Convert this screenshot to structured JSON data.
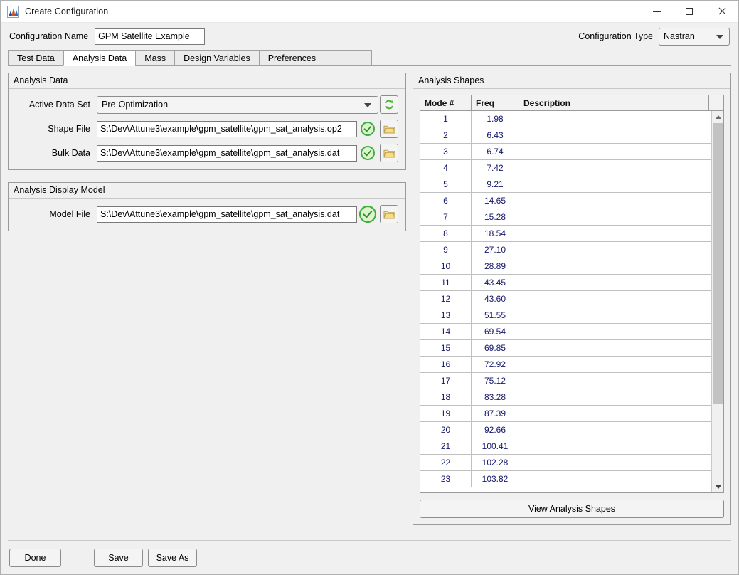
{
  "window": {
    "title": "Create Configuration",
    "app_icon": "matlab-icon",
    "minimize_label": "–",
    "maximize_label": "□",
    "close_label": "✕"
  },
  "config": {
    "name_label": "Configuration Name",
    "name_value": "GPM Satellite Example",
    "name_placeholder": "",
    "type_label": "Configuration Type",
    "type_value": "Nastran"
  },
  "tabs": [
    {
      "label": "Test Data",
      "active": false
    },
    {
      "label": "Analysis Data",
      "active": true
    },
    {
      "label": "Mass",
      "active": false
    },
    {
      "label": "Design Variables",
      "active": false
    },
    {
      "label": "Preferences",
      "active": false
    }
  ],
  "analysis_data": {
    "title": "Analysis Data",
    "rows": [
      {
        "label": "Active Data Set",
        "value": "Pre-Optimization",
        "control": "dropdown",
        "action_icon": "refresh-icon"
      },
      {
        "label": "Shape File",
        "value": "S:\\Dev\\Attune3\\example\\gpm_satellite\\gpm_sat_analysis.op2",
        "control": "textfield",
        "status_icon": "check-circle-icon",
        "action_icon": "folder-icon"
      },
      {
        "label": "Bulk Data",
        "value": "S:\\Dev\\Attune3\\example\\gpm_satellite\\gpm_sat_analysis.dat",
        "control": "textfield",
        "status_icon": "check-circle-icon",
        "action_icon": "folder-icon"
      }
    ]
  },
  "display_model": {
    "title": "Analysis Display Model",
    "rows": [
      {
        "label": "Model File",
        "value": "S:\\Dev\\Attune3\\example\\gpm_satellite\\gpm_sat_analysis.dat",
        "control": "textfield",
        "status_icon": "check-circle-icon",
        "action_icon": "folder-icon"
      }
    ]
  },
  "analysis_shapes": {
    "title": "Analysis Shapes",
    "columns": [
      "Mode #",
      "Freq",
      "Description"
    ],
    "rows": [
      {
        "mode": "1",
        "freq": "1.98",
        "description": ""
      },
      {
        "mode": "2",
        "freq": "6.43",
        "description": ""
      },
      {
        "mode": "3",
        "freq": "6.74",
        "description": ""
      },
      {
        "mode": "4",
        "freq": "7.42",
        "description": ""
      },
      {
        "mode": "5",
        "freq": "9.21",
        "description": ""
      },
      {
        "mode": "6",
        "freq": "14.65",
        "description": ""
      },
      {
        "mode": "7",
        "freq": "15.28",
        "description": ""
      },
      {
        "mode": "8",
        "freq": "18.54",
        "description": ""
      },
      {
        "mode": "9",
        "freq": "27.10",
        "description": ""
      },
      {
        "mode": "10",
        "freq": "28.89",
        "description": ""
      },
      {
        "mode": "11",
        "freq": "43.45",
        "description": ""
      },
      {
        "mode": "12",
        "freq": "43.60",
        "description": ""
      },
      {
        "mode": "13",
        "freq": "51.55",
        "description": ""
      },
      {
        "mode": "14",
        "freq": "69.54",
        "description": ""
      },
      {
        "mode": "15",
        "freq": "69.85",
        "description": ""
      },
      {
        "mode": "16",
        "freq": "72.92",
        "description": ""
      },
      {
        "mode": "17",
        "freq": "75.12",
        "description": ""
      },
      {
        "mode": "18",
        "freq": "83.28",
        "description": ""
      },
      {
        "mode": "19",
        "freq": "87.39",
        "description": ""
      },
      {
        "mode": "20",
        "freq": "92.66",
        "description": ""
      },
      {
        "mode": "21",
        "freq": "100.41",
        "description": ""
      },
      {
        "mode": "22",
        "freq": "102.28",
        "description": ""
      },
      {
        "mode": "23",
        "freq": "103.82",
        "description": ""
      }
    ],
    "view_button_label": "View Analysis Shapes"
  },
  "footer": {
    "done_label": "Done",
    "save_label": "Save",
    "save_as_label": "Save As"
  },
  "colors": {
    "window_bg": "#f0f0f0",
    "titlebar_bg": "#ffffff",
    "status_ok": "#3fae3f",
    "folder": "#f5dd8a",
    "refresh": "#4caf33",
    "table_text": "#14166b",
    "border": "#9a9a9a"
  }
}
